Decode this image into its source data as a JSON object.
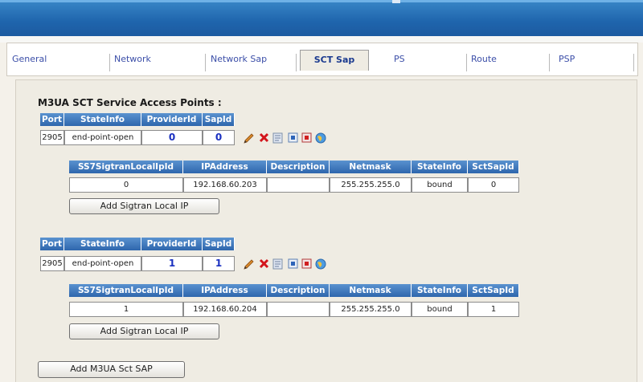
{
  "tabs": [
    {
      "label": "General"
    },
    {
      "label": "Network"
    },
    {
      "label": "Network Sap"
    },
    {
      "label": "SCT Sap"
    },
    {
      "label": "PS"
    },
    {
      "label": "Route"
    },
    {
      "label": "PSP"
    }
  ],
  "active_tab": "SCT Sap",
  "section_title": "M3UA SCT Service Access Points :",
  "sap_headers": [
    "Port",
    "StateInfo",
    "ProviderId",
    "SapId"
  ],
  "local_ip_headers": [
    "SS7SigtranLocalIpId",
    "IPAddress",
    "Description",
    "Netmask",
    "StateInfo",
    "SctSapId"
  ],
  "saps": [
    {
      "port": "2905",
      "state": "end-point-open",
      "provider_id": "0",
      "sap_id": "0",
      "local_ip": {
        "id": "0",
        "ip": "192.168.60.203",
        "description": "",
        "netmask": "255.255.255.0",
        "state": "bound",
        "sct_sap_id": "0"
      },
      "add_button": "Add Sigtran Local IP"
    },
    {
      "port": "2905",
      "state": "end-point-open",
      "provider_id": "1",
      "sap_id": "1",
      "local_ip": {
        "id": "1",
        "ip": "192.168.60.204",
        "description": "",
        "netmask": "255.255.255.0",
        "state": "bound",
        "sct_sap_id": "1"
      },
      "add_button": "Add Sigtran Local IP"
    }
  ],
  "add_sap_button": "Add M3UA Sct SAP",
  "row_icons": [
    "edit-pencil-icon",
    "delete-x-icon",
    "document-icon",
    "window-icon",
    "stop-icon",
    "globe-icon"
  ]
}
